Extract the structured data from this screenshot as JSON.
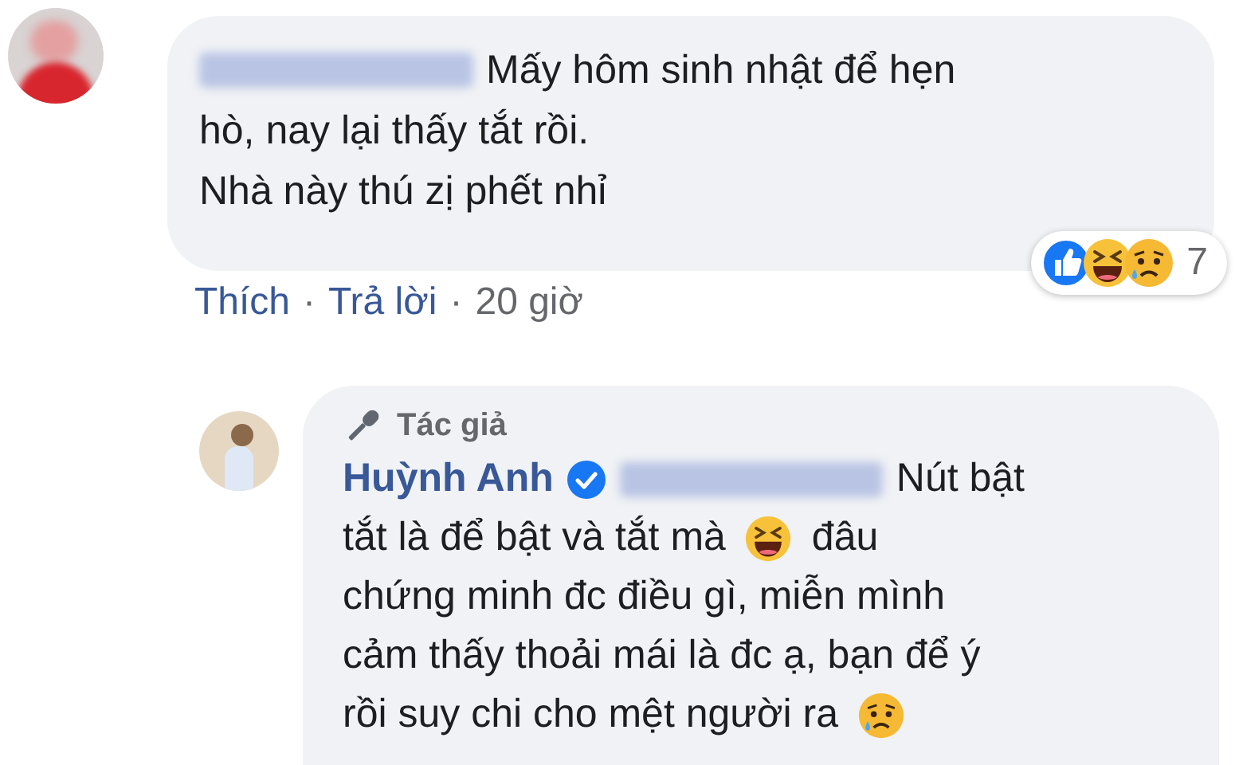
{
  "comments": [
    {
      "kind": "comment",
      "author_blurred": true,
      "lines": [
        [
          {
            "kind": "text",
            "text": "Mấy hôm sinh nhật để hẹn"
          }
        ],
        [
          {
            "kind": "text",
            "text": "hò, nay lại thấy tắt rồi."
          }
        ],
        [
          {
            "kind": "text",
            "text": "Nhà này thú zị phết nhỉ"
          }
        ]
      ],
      "actions": [
        {
          "kind": "link",
          "text": "Thích"
        },
        {
          "kind": "separator",
          "text": "·"
        },
        {
          "kind": "link",
          "text": "Trả lời"
        },
        {
          "kind": "separator",
          "text": "·"
        },
        {
          "kind": "time",
          "text": "20 giờ"
        }
      ],
      "reactions": {
        "icons": [
          {
            "kind": "like"
          },
          {
            "kind": "haha"
          },
          {
            "kind": "sad"
          }
        ],
        "count": "7"
      }
    },
    {
      "kind": "reply",
      "badge": "Tác giả",
      "author": "Huỳnh Anh",
      "verified": true,
      "mention_blurred": true,
      "lines": [
        [
          {
            "kind": "text",
            "text": "Nút bật"
          }
        ],
        [
          {
            "kind": "text",
            "text": "tắt là để bật và tắt mà"
          },
          {
            "kind": "laughing"
          },
          {
            "kind": "text",
            "text": "đâu"
          }
        ],
        [
          {
            "kind": "text",
            "text": "chứng minh đc điều gì, miễn mình"
          }
        ],
        [
          {
            "kind": "text",
            "text": "cảm thấy thoải mái là đc ạ, bạn để ý"
          }
        ],
        [
          {
            "kind": "text",
            "text": "rồi suy chi cho mệt người ra"
          },
          {
            "kind": "sad"
          }
        ]
      ]
    }
  ]
}
